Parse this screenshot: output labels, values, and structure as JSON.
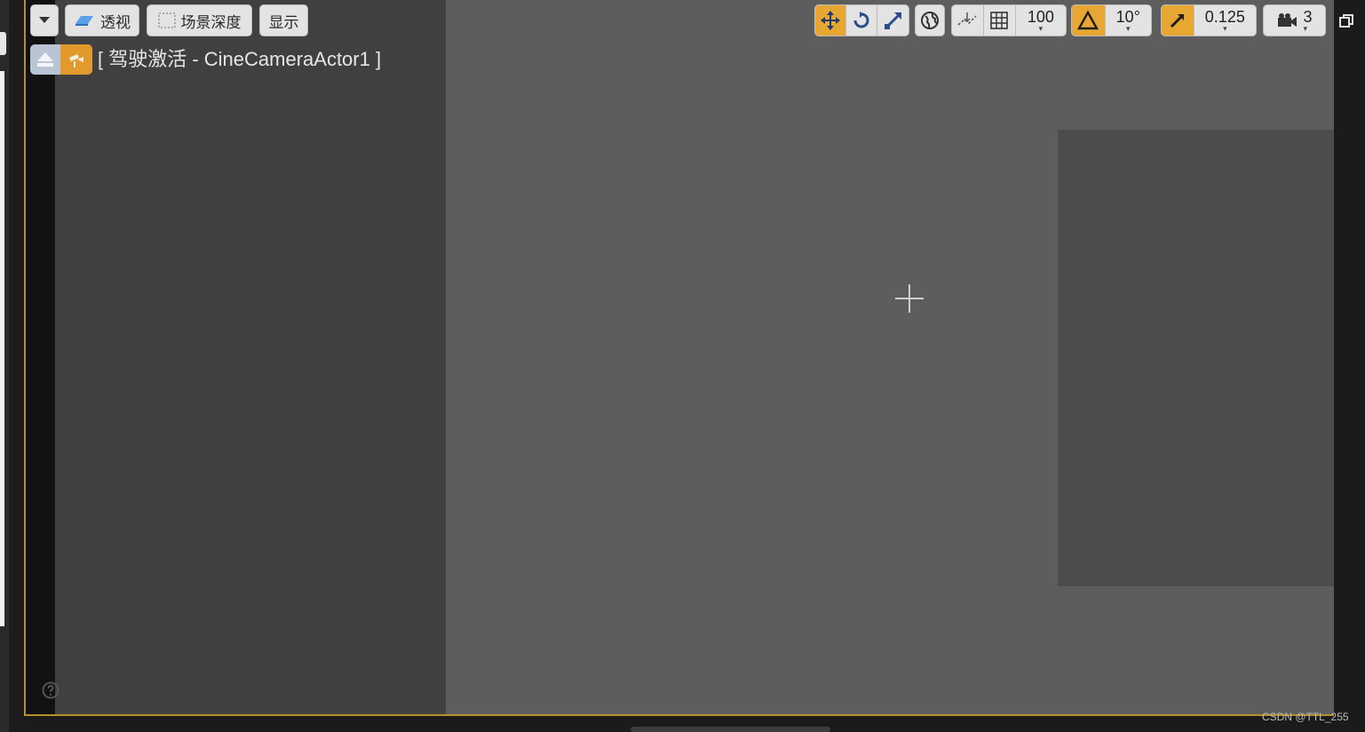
{
  "toolbar": {
    "menu_icon": "chevron-down-icon",
    "perspective_label": "透视",
    "scene_depth_label": "场景深度",
    "show_label": "显示",
    "grid_snap_value": "100",
    "rotation_snap_value": "10°",
    "scale_snap_value": "0.125",
    "camera_speed_value": "3"
  },
  "pilot": {
    "label": "[ 驾驶激活 - CineCameraActor1 ]"
  },
  "colors": {
    "active_orange": "#e8a632",
    "viewport_bg": "#5d5d5d",
    "frame_border": "#b58f2a"
  },
  "watermark": "CSDN @TTL_255"
}
